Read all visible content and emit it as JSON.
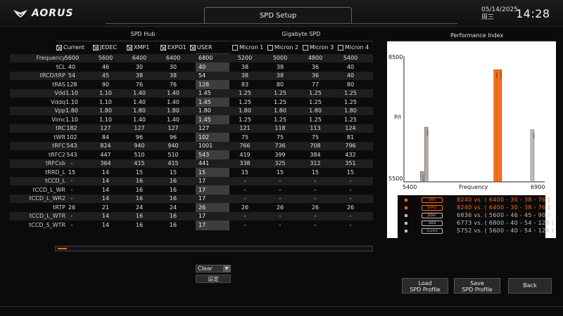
{
  "header": {
    "brand": "AORUS",
    "title": "SPD Setup",
    "date": "05/14/2025",
    "weekday": "周三",
    "time": "14:28"
  },
  "table": {
    "group_spd_hub": "SPD Hub",
    "group_gigabyte_spd": "Gigabyte SPD",
    "profiles": [
      {
        "label": "Current",
        "checked": true,
        "checkbox": false
      },
      {
        "label": "JEDEC",
        "checked": true,
        "checkbox": true
      },
      {
        "label": "XMP1",
        "checked": true,
        "checkbox": true
      },
      {
        "label": "EXPO1",
        "checked": true,
        "checkbox": true
      },
      {
        "label": "USER",
        "checked": true,
        "checkbox": true
      },
      {
        "label": "Micron 1",
        "checked": false,
        "checkbox": true
      },
      {
        "label": "Micron 2",
        "checked": false,
        "checkbox": true
      },
      {
        "label": "Micron 3",
        "checked": false,
        "checkbox": true
      },
      {
        "label": "Micron 4",
        "checked": false,
        "checkbox": true
      }
    ],
    "rows": [
      {
        "label": "Frequency",
        "values": [
          "5600",
          "5600",
          "6400",
          "6400",
          "6800",
          "5200",
          "5000",
          "4800",
          "5400"
        ]
      },
      {
        "label": "tCL",
        "values": [
          "40",
          "46",
          "30",
          "30",
          "40",
          "38",
          "38",
          "36",
          "40"
        ]
      },
      {
        "label": "tRCD/tRP",
        "values": [
          "54",
          "45",
          "38",
          "38",
          "54",
          "38",
          "38",
          "36",
          "40"
        ]
      },
      {
        "label": "tRAS",
        "values": [
          "128",
          "90",
          "76",
          "76",
          "128",
          "83",
          "80",
          "77",
          "80"
        ]
      },
      {
        "label": "Vdd",
        "values": [
          "1.10",
          "1.10",
          "1.40",
          "1.40",
          "1.45",
          "1.25",
          "1.25",
          "1.25",
          "1.25"
        ]
      },
      {
        "label": "Vddq",
        "values": [
          "1.10",
          "1.10",
          "1.40",
          "1.40",
          "1.45",
          "1.25",
          "1.25",
          "1.25",
          "1.25"
        ]
      },
      {
        "label": "Vpp",
        "values": [
          "1.80",
          "1.80",
          "1.80",
          "1.80",
          "1.80",
          "1.80",
          "1.80",
          "1.80",
          "1.80"
        ]
      },
      {
        "label": "Vimc",
        "values": [
          "1.10",
          "1.10",
          "1.40",
          "1.40",
          "1.45",
          "1.25",
          "1.25",
          "1.25",
          "1.25"
        ]
      },
      {
        "label": "tRC",
        "values": [
          "182",
          "127",
          "127",
          "127",
          "127",
          "121",
          "118",
          "113",
          "124"
        ]
      },
      {
        "label": "tWR",
        "values": [
          "102",
          "84",
          "96",
          "96",
          "102",
          "75",
          "75",
          "75",
          "81"
        ]
      },
      {
        "label": "tRFC",
        "values": [
          "543",
          "824",
          "940",
          "940",
          "1001",
          "766",
          "736",
          "708",
          "796"
        ]
      },
      {
        "label": "tRFC2",
        "values": [
          "543",
          "447",
          "510",
          "510",
          "543",
          "419",
          "399",
          "384",
          "432"
        ]
      },
      {
        "label": "tRFCsb",
        "values": [
          "-",
          "364",
          "415",
          "415",
          "441",
          "338",
          "325",
          "312",
          "351"
        ]
      },
      {
        "label": "tRRD_L",
        "values": [
          "15",
          "14",
          "15",
          "15",
          "15",
          "15",
          "15",
          "15",
          "15"
        ]
      },
      {
        "label": "tCCD_L",
        "values": [
          "-",
          "14",
          "16",
          "16",
          "17",
          "-",
          "-",
          "-",
          "-"
        ]
      },
      {
        "label": "tCCD_L_WR",
        "values": [
          "-",
          "14",
          "16",
          "16",
          "17",
          "-",
          "-",
          "-",
          "-"
        ]
      },
      {
        "label": "tCCD_L_WR2",
        "values": [
          "-",
          "14",
          "16",
          "16",
          "17",
          "-",
          "-",
          "-",
          "-"
        ]
      },
      {
        "label": "tRTP",
        "values": [
          "26",
          "21",
          "24",
          "24",
          "26",
          "26",
          "26",
          "26",
          "26"
        ]
      },
      {
        "label": "tCCD_L_WTR",
        "values": [
          "-",
          "14",
          "16",
          "16",
          "17",
          "-",
          "-",
          "-",
          "-"
        ]
      },
      {
        "label": "tCCD_S_WTR",
        "values": [
          "-",
          "14",
          "16",
          "16",
          "17",
          "-",
          "-",
          "-",
          "-"
        ]
      }
    ]
  },
  "controls": {
    "slider_value": 0.03,
    "dropdown_value": "Clear",
    "set_label": "设定"
  },
  "performance": {
    "title": "Performance Index",
    "legend": [
      {
        "tag": "XMP1",
        "text": "8240 vs. ( 6400 - 30 - 38 - 76 )",
        "color": "#ff6a10"
      },
      {
        "tag": "EXPO1",
        "text": "8240 vs. ( 6400 - 30 - 38 - 76 )",
        "color": "#ff6a10"
      },
      {
        "tag": "JEDEC",
        "text": "6836 vs. ( 5600 - 46 - 45 - 90 )",
        "color": "#c8b8a8"
      },
      {
        "tag": "USER",
        "text": "6773 vs. ( 6800 - 40 - 54 - 128 )",
        "color": "#c0c0c0"
      },
      {
        "tag": "Current",
        "text": "5752 vs. ( 5600 - 40 - 54 - 128 )",
        "color": "#c0c0c0"
      }
    ]
  },
  "chart_data": {
    "type": "bar",
    "title": "",
    "xlabel": "Frequency",
    "ylabel": "P/I",
    "xlim": [
      5400,
      6900
    ],
    "ylim": [
      5500,
      8500
    ],
    "x_ticks": [
      "5400",
      "6900"
    ],
    "y_ticks": [
      "8500",
      "5500"
    ],
    "series": [
      {
        "name": "Current",
        "x": 5600,
        "value": 5752,
        "color": "#a8a8a8"
      },
      {
        "name": "JEDEC",
        "x": 5600,
        "value": 6836,
        "color": "#b8a89a"
      },
      {
        "name": "XMP1",
        "x": 6400,
        "value": 8240,
        "color": "#ff6a10"
      },
      {
        "name": "EXPO1",
        "x": 6400,
        "value": 8240,
        "color": "#ff6a10"
      },
      {
        "name": "USER",
        "x": 6800,
        "value": 6773,
        "color": "#bdbdbd"
      }
    ]
  },
  "buttons": {
    "load_spd": [
      "Load",
      "SPD Profile"
    ],
    "save_spd": [
      "Save",
      "SPD Profile"
    ],
    "back": "Back"
  }
}
